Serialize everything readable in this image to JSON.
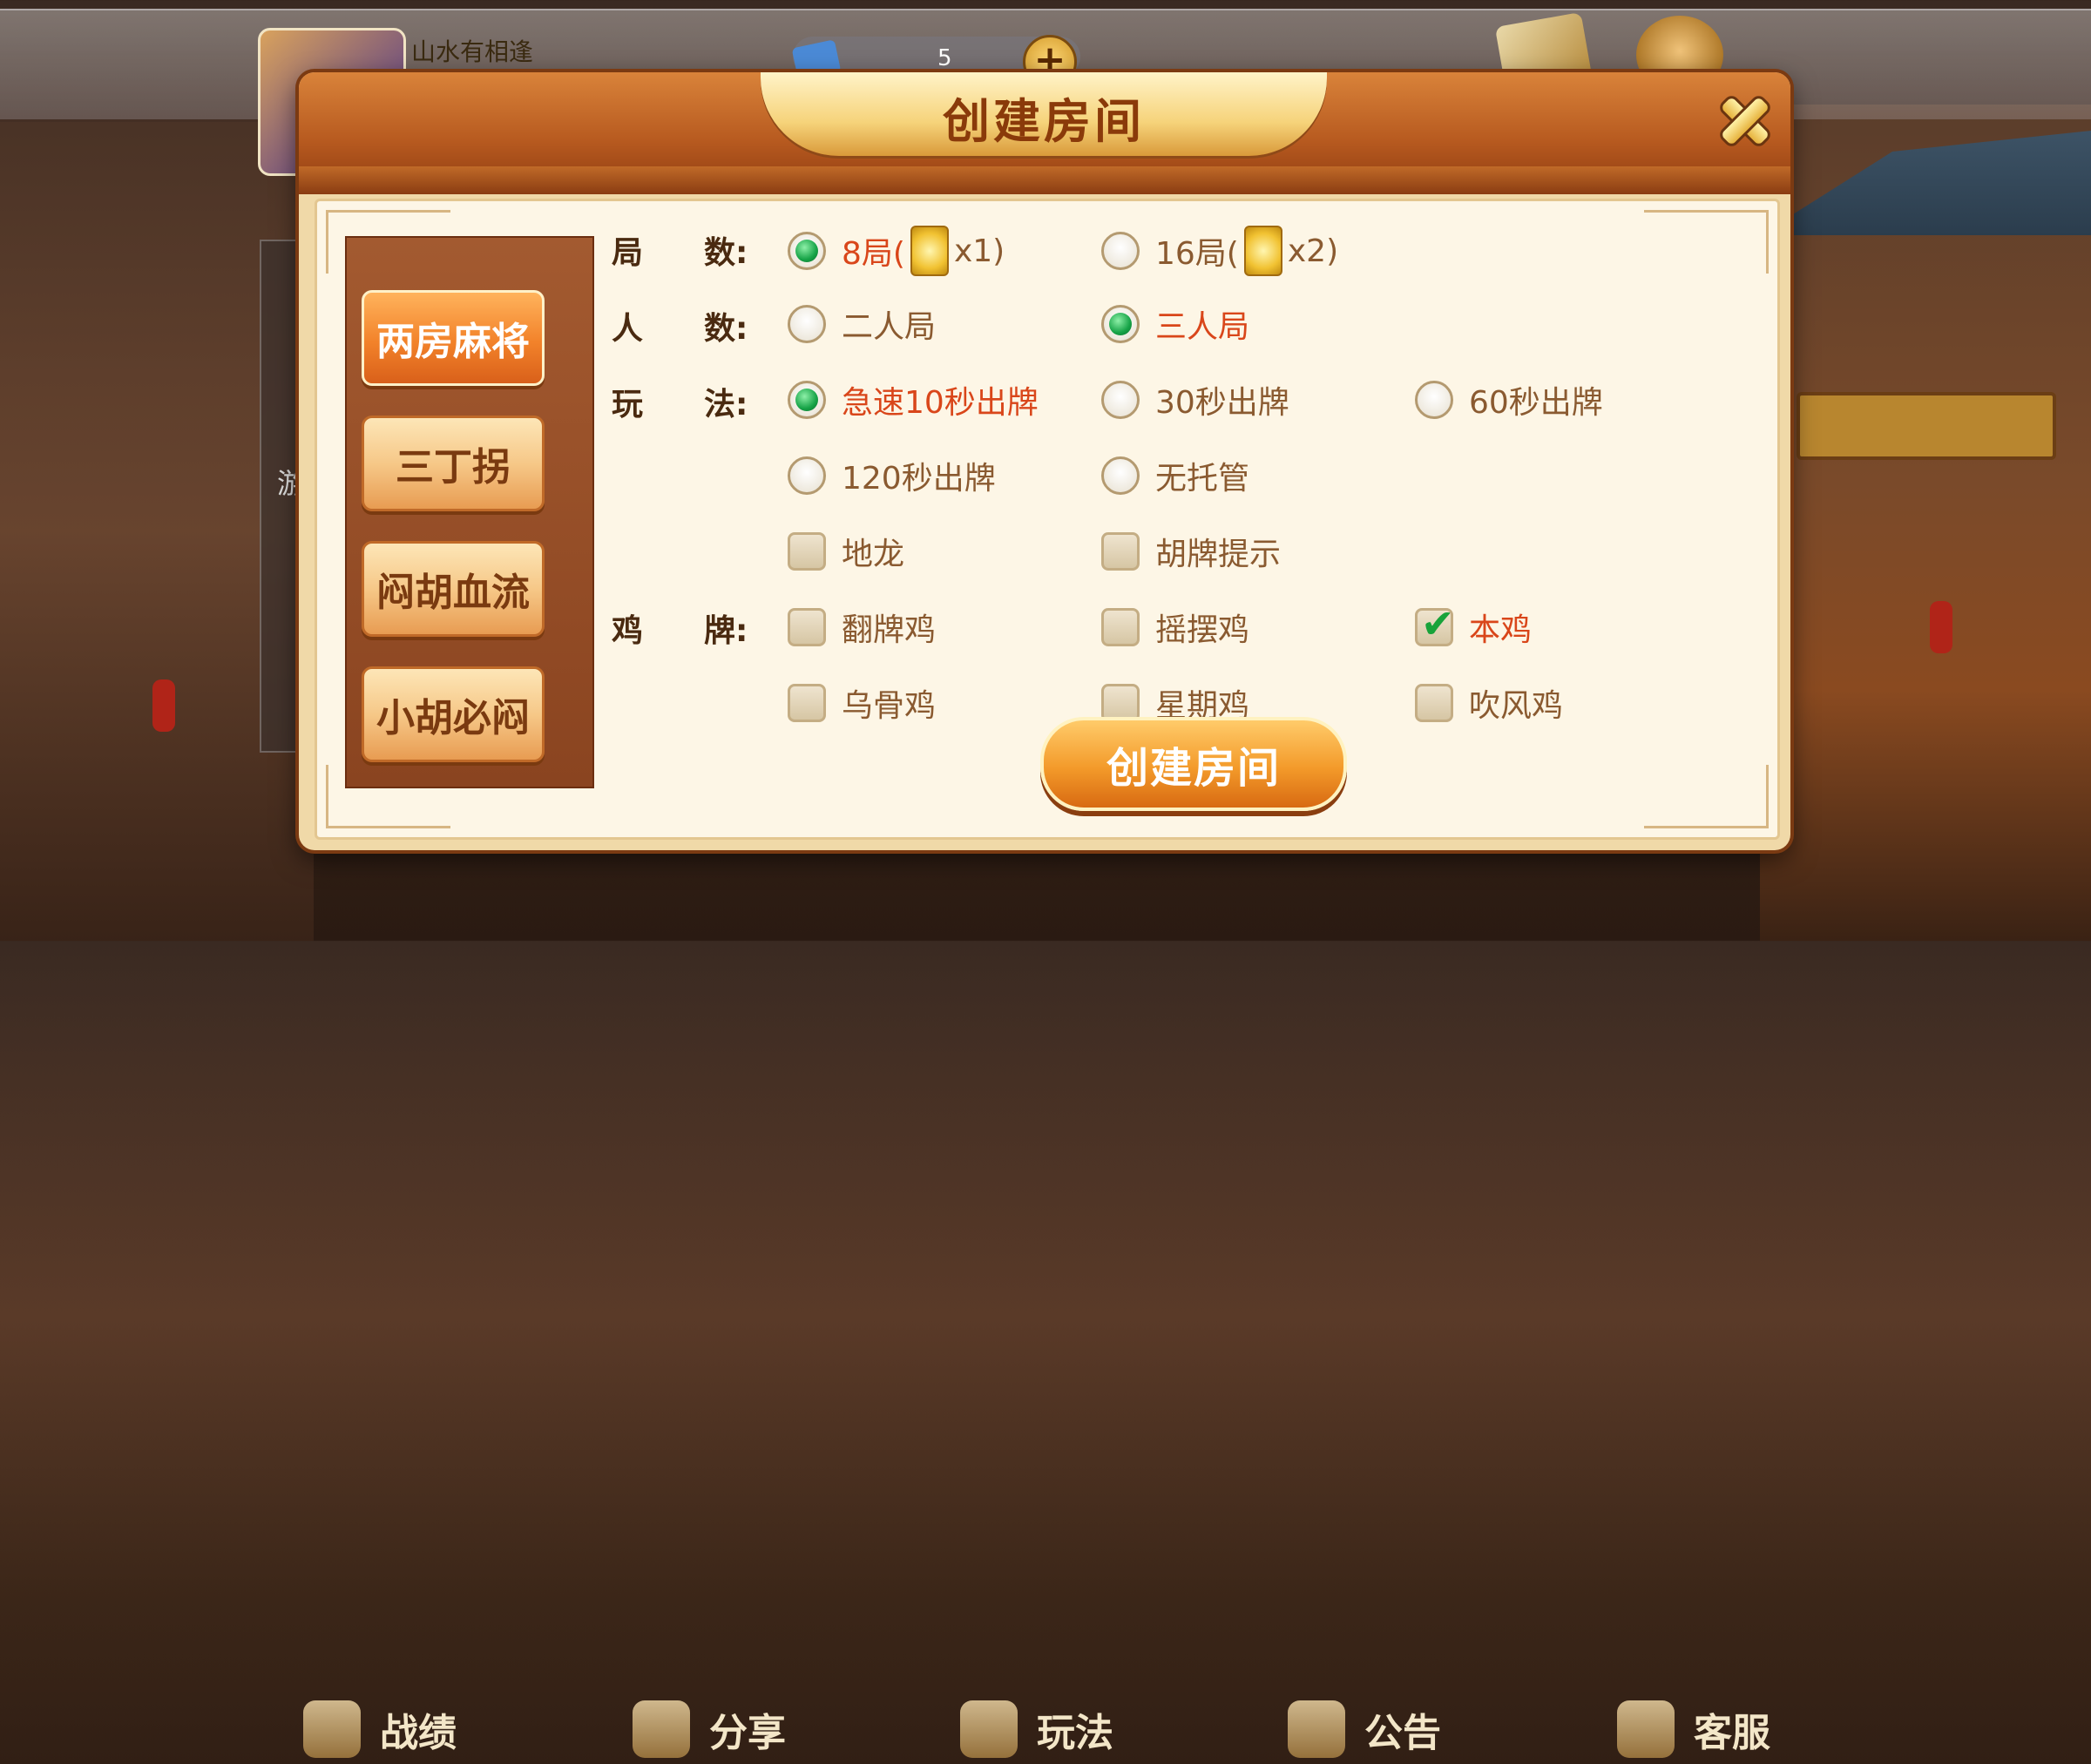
{
  "top_bar": {
    "username": "山水有相逢",
    "room_card_count": "5"
  },
  "background_panel": {
    "text": "游戏"
  },
  "bottom_nav": [
    {
      "label": "战绩",
      "icon": "trophy-icon"
    },
    {
      "label": "分享",
      "icon": "share-icon"
    },
    {
      "label": "玩法",
      "icon": "rules-book-icon"
    },
    {
      "label": "公告",
      "icon": "envelope-icon"
    },
    {
      "label": "客服",
      "icon": "headset-icon"
    }
  ],
  "dialog": {
    "title": "创建房间",
    "create_button": "创建房间",
    "game_types": [
      {
        "label": "两房麻将",
        "selected": true
      },
      {
        "label": "三丁拐",
        "selected": false
      },
      {
        "label": "闷胡血流",
        "selected": false
      },
      {
        "label": "小胡必闷",
        "selected": false
      }
    ],
    "labels": {
      "rounds_a": "局",
      "rounds_b": "数:",
      "players_a": "人",
      "players_b": "数:",
      "play_a": "玩",
      "play_b": "法:",
      "chicken_a": "鸡",
      "chicken_b": "牌:"
    },
    "rounds": [
      {
        "prefix": "8局(",
        "suffix": "x1)",
        "selected": true
      },
      {
        "prefix": "16局(",
        "suffix": "x2)",
        "selected": false
      }
    ],
    "players": [
      {
        "label": "二人局",
        "selected": false
      },
      {
        "label": "三人局",
        "selected": true
      }
    ],
    "play_modes": [
      {
        "label": "急速10秒出牌",
        "selected": true
      },
      {
        "label": "30秒出牌",
        "selected": false
      },
      {
        "label": "60秒出牌",
        "selected": false
      },
      {
        "label": "120秒出牌",
        "selected": false
      },
      {
        "label": "无托管",
        "selected": false
      }
    ],
    "extras": [
      {
        "label": "地龙",
        "checked": false
      },
      {
        "label": "胡牌提示",
        "checked": false
      }
    ],
    "chicken": [
      {
        "label": "翻牌鸡",
        "checked": false
      },
      {
        "label": "摇摆鸡",
        "checked": false
      },
      {
        "label": "本鸡",
        "checked": true
      },
      {
        "label": "乌骨鸡",
        "checked": false
      },
      {
        "label": "星期鸡",
        "checked": false
      },
      {
        "label": "吹风鸡",
        "checked": false
      }
    ]
  },
  "colors": {
    "selected_text": "#d9461a",
    "normal_text": "#8a5a30",
    "radio_on": "#16a347",
    "accent_orange": "#f2822a"
  }
}
